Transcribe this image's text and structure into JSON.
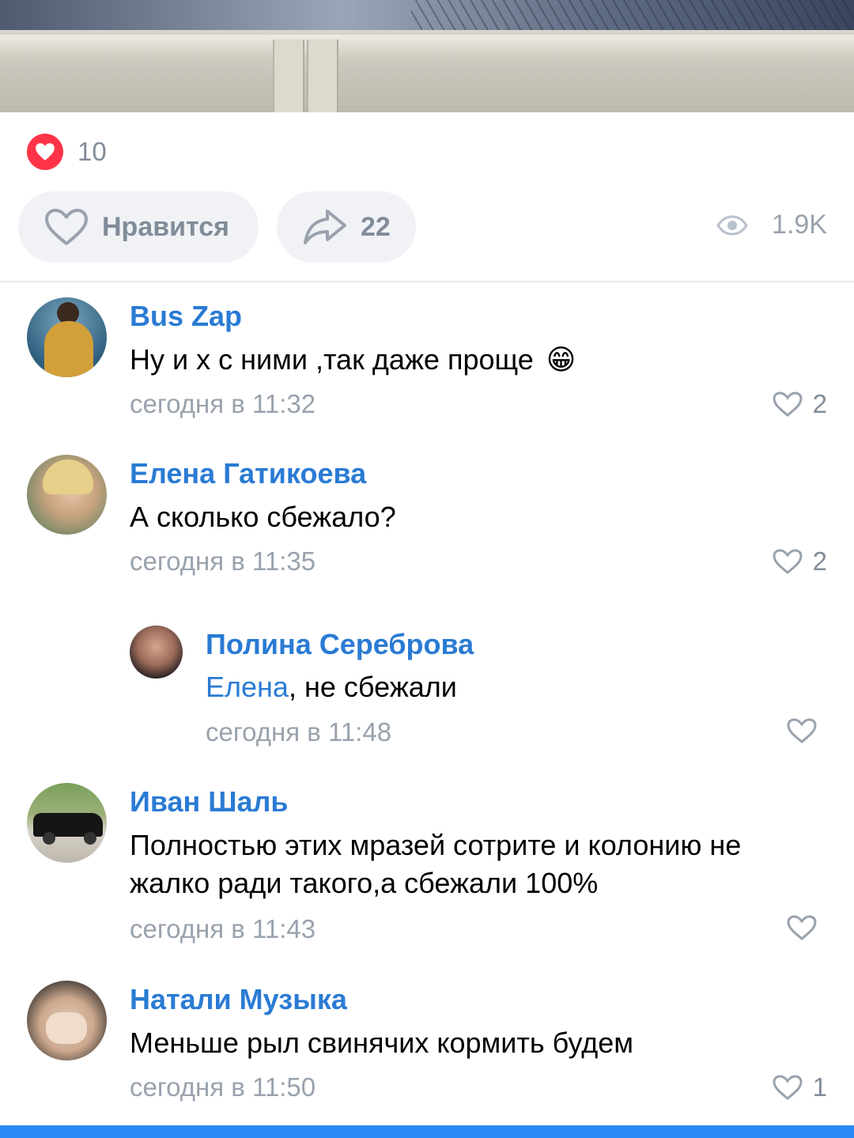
{
  "post": {
    "likes_count": "10",
    "like_button_label": "Нравится",
    "share_count": "22",
    "views_count": "1.9K"
  },
  "comments": [
    {
      "author": "Bus Zap",
      "text": "Ну и х с ними ,так даже проще",
      "emoji": "😁",
      "time": "сегодня в 11:32",
      "likes": "2"
    },
    {
      "author": "Елена Гатикоева",
      "text": "А сколько сбежало?",
      "time": "сегодня в 11:35",
      "likes": "2"
    },
    {
      "author": "Полина Сереброва",
      "mention": "Елена",
      "text": ", не сбежали",
      "time": "сегодня в 11:48",
      "likes": ""
    },
    {
      "author": "Иван Шаль",
      "text": "Полностью этих мразей сотрите и колонию не жалко ради такого,а сбежали 100%",
      "time": "сегодня в 11:43",
      "likes": ""
    },
    {
      "author": "Натали Музыка",
      "text": "Меньше рыл свинячих кормить будем",
      "time": "сегодня в 11:50",
      "likes": "1"
    }
  ],
  "colors": {
    "link": "#2a7bd4",
    "secondary_text": "#99a2ad",
    "like_red": "#ff3347",
    "pill_bg": "#f0f2f5",
    "accent_bar": "#2a8af5"
  }
}
